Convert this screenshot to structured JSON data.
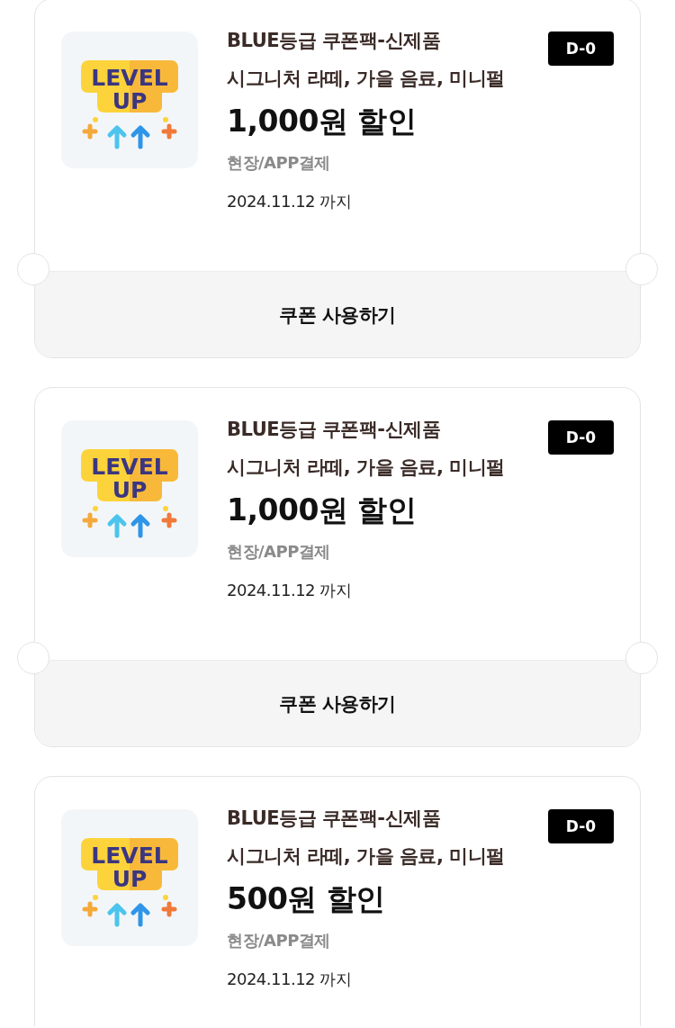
{
  "coupons": [
    {
      "icon_text": [
        "LEVEL",
        "UP"
      ],
      "title": "BLUE등급 쿠폰팩-신제품",
      "items": "시그니처 라떼, 가을 음료, 미니펄",
      "discount": "1,000원 할인",
      "usage": "현장/APP결제",
      "expiry": "2024.11.12 까지",
      "dday": "D-0",
      "button": "쿠폰 사용하기"
    },
    {
      "icon_text": [
        "LEVEL",
        "UP"
      ],
      "title": "BLUE등급 쿠폰팩-신제품",
      "items": "시그니처 라떼, 가을 음료, 미니펄",
      "discount": "1,000원 할인",
      "usage": "현장/APP결제",
      "expiry": "2024.11.12 까지",
      "dday": "D-0",
      "button": "쿠폰 사용하기"
    },
    {
      "icon_text": [
        "LEVEL",
        "UP"
      ],
      "title": "BLUE등급 쿠폰팩-신제품",
      "items": "시그니처 라떼, 가을 음료, 미니펄",
      "discount": "500원 할인",
      "usage": "현장/APP결제",
      "expiry": "2024.11.12 까지",
      "dday": "D-0"
    }
  ]
}
